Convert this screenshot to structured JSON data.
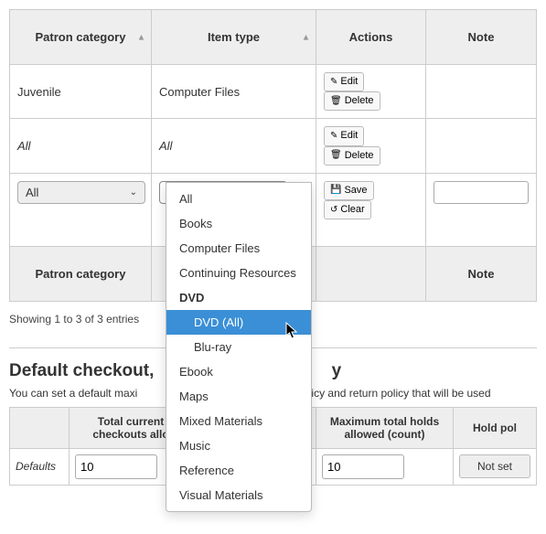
{
  "table": {
    "headers": {
      "patron_category": "Patron category",
      "item_type": "Item type",
      "actions": "Actions",
      "note": "Note"
    },
    "rows": [
      {
        "patron_category": "Juvenile",
        "item_type": "Computer Files",
        "italic": false
      },
      {
        "patron_category": "All",
        "item_type": "All",
        "italic": true
      }
    ],
    "buttons": {
      "edit": "Edit",
      "delete": "Delete",
      "save": "Save",
      "clear": "Clear"
    },
    "inputs": {
      "patron_category_select": "All",
      "item_type_select": "DVD (All)",
      "note_value": ""
    }
  },
  "dropdown": {
    "items": [
      {
        "label": "All"
      },
      {
        "label": "Books"
      },
      {
        "label": "Computer Files"
      },
      {
        "label": "Continuing Resources"
      },
      {
        "label": "DVD",
        "bold": true
      },
      {
        "label": "DVD (All)",
        "child": true,
        "highlight": true
      },
      {
        "label": "Blu-ray",
        "child": true
      },
      {
        "label": "Ebook"
      },
      {
        "label": "Maps"
      },
      {
        "label": "Mixed Materials"
      },
      {
        "label": "Music"
      },
      {
        "label": "Reference"
      },
      {
        "label": "Visual Materials"
      }
    ]
  },
  "entries_text": "Showing 1 to 3 of 3 entries",
  "section": {
    "title_prefix": "Default checkout, ",
    "title_suffix": "y",
    "desc_prefix": "You can set a default maxi",
    "desc_suffix": "old policy and return policy that will be used",
    "headers": {
      "col0": "",
      "col1": "Total current checkouts allo",
      "col2": "",
      "col3": "Maximum total holds allowed (count)",
      "col4": "Hold pol"
    },
    "row_label": "Defaults",
    "values": {
      "checkouts": "10",
      "holds": "10",
      "hold_policy": "Not set"
    }
  }
}
